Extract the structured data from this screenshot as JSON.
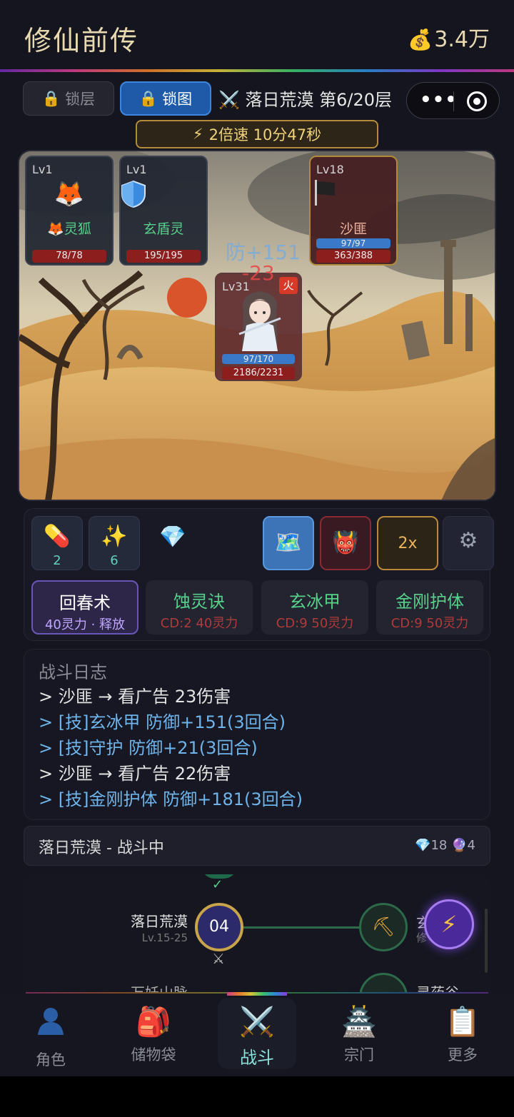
{
  "header": {
    "title": "修仙前传",
    "money_icon": "money-bag-icon",
    "money": "3.4万"
  },
  "toolbar": {
    "lock_layer": "锁层",
    "lock_map": "锁图",
    "stage": "落日荒漠 第6/20层",
    "speed": "2倍速 10分47秒"
  },
  "scene": {
    "fox": {
      "level": "Lv1",
      "name": "🦊灵狐",
      "hp": "78/78"
    },
    "shield": {
      "level": "Lv1",
      "name": "玄盾灵",
      "hp": "195/195"
    },
    "enemy": {
      "level": "Lv18",
      "name": "沙匪",
      "mp": "97/97",
      "hp": "363/388"
    },
    "hero": {
      "level": "Lv31",
      "element": "火",
      "mp": "97/170",
      "hp": "2186/2231"
    },
    "float_def": "防+151",
    "float_dmg": "-23"
  },
  "items": {
    "pill_count": "2",
    "spark_count": "6",
    "speed_label": "2x"
  },
  "skills": [
    {
      "name": "回春术",
      "cost": "40灵力 · 释放"
    },
    {
      "name": "蚀灵诀",
      "cost": "CD:2  40灵力"
    },
    {
      "name": "玄冰甲",
      "cost": "CD:9  50灵力"
    },
    {
      "name": "金刚护体",
      "cost": "CD:9  50灵力"
    }
  ],
  "log": {
    "title": "战斗日志",
    "lines": [
      "> 沙匪 → 看广告 23伤害",
      "> [技]玄冰甲 防御+151(3回合)",
      "> [技]守护 防御+21(3回合)",
      "> 沙匪 → 看广告 22伤害",
      "> [技]金刚护体 防御+181(3回合)"
    ]
  },
  "status": {
    "text": "落日荒漠 - 战斗中",
    "gems": "💎18",
    "orbs": "🔮4"
  },
  "map": {
    "current_name": "落日荒漠",
    "current_range": "Lv.15-25",
    "current_num": "04",
    "right_label": "玄",
    "right_sub": "修",
    "next_left": "万妖山脉",
    "next_right": "灵药谷"
  },
  "nav": [
    {
      "label": "角色",
      "icon": "person-icon"
    },
    {
      "label": "储物袋",
      "icon": "backpack-icon"
    },
    {
      "label": "战斗",
      "icon": "crossed-swords-icon"
    },
    {
      "label": "宗门",
      "icon": "temple-icon"
    },
    {
      "label": "更多",
      "icon": "clipboard-icon"
    }
  ],
  "colors": {
    "accent_gold": "#e8d9b0",
    "active_blue": "#1f5aa8",
    "skill_green": "#56d08a",
    "log_blue": "#6eb4ea"
  }
}
